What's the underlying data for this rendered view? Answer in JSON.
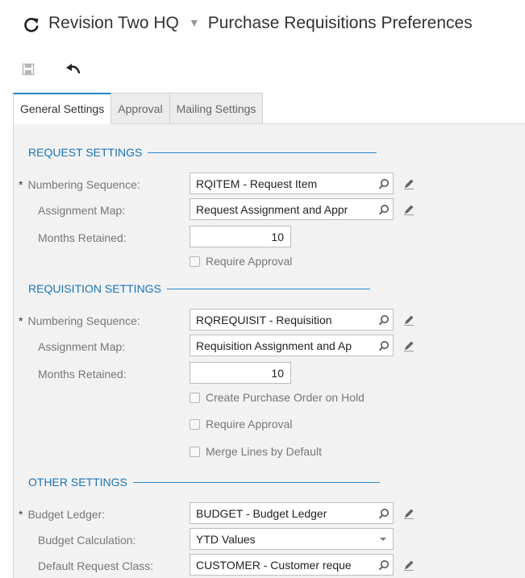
{
  "header": {
    "company": "Revision Two HQ",
    "screen": "Purchase Requisitions Preferences"
  },
  "tabs": [
    {
      "label": "General Settings"
    },
    {
      "label": "Approval"
    },
    {
      "label": "Mailing Settings"
    }
  ],
  "request_settings": {
    "title": "REQUEST SETTINGS",
    "numbering_label": "Numbering Sequence:",
    "numbering_value": "RQITEM - Request Item",
    "assignment_label": "Assignment Map:",
    "assignment_value": "Request Assignment and Appr",
    "months_label": "Months Retained:",
    "months_value": "10",
    "require_approval": "Require Approval"
  },
  "requisition_settings": {
    "title": "REQUISITION SETTINGS",
    "numbering_label": "Numbering Sequence:",
    "numbering_value": "RQREQUISIT - Requisition",
    "assignment_label": "Assignment Map:",
    "assignment_value": "Requisition Assignment and Ap",
    "months_label": "Months Retained:",
    "months_value": "10",
    "create_po_hold": "Create Purchase Order on Hold",
    "require_approval": "Require Approval",
    "merge_lines": "Merge Lines by Default"
  },
  "other_settings": {
    "title": "OTHER SETTINGS",
    "budget_ledger_label": "Budget Ledger:",
    "budget_ledger_value": "BUDGET - Budget Ledger",
    "budget_calc_label": "Budget Calculation:",
    "budget_calc_value": "YTD Values",
    "default_class_label": "Default Request Class:",
    "default_class_value": "CUSTOMER - Customer reque"
  },
  "icons": {
    "refresh": "refresh-icon",
    "save": "save-icon",
    "undo": "undo-icon",
    "search": "search-icon",
    "edit": "pencil-icon",
    "dropdown": "chevron-down-icon"
  },
  "colors": {
    "accent": "#2b87c8",
    "section_text": "#1b73b5",
    "panel_bg": "#f2f2f2"
  }
}
